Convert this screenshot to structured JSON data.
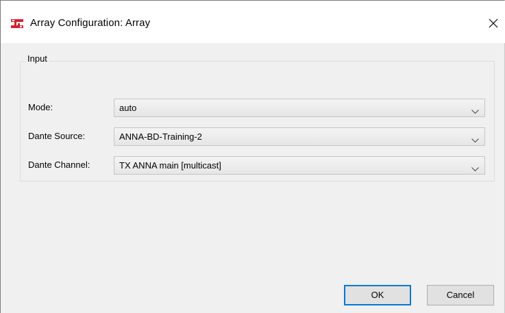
{
  "window": {
    "title": "Array Configuration: Array",
    "app_icon": "array-config-icon",
    "close_icon": "close-icon"
  },
  "input_group": {
    "legend": "Input",
    "fields": [
      {
        "label": "Mode:",
        "value": "auto"
      },
      {
        "label": "Dante Source:",
        "value": "ANNA-BD-Training-2"
      },
      {
        "label": "Dante Channel:",
        "value": "TX ANNA main [multicast]"
      }
    ]
  },
  "buttons": {
    "ok": "OK",
    "cancel": "Cancel"
  },
  "colors": {
    "accent": "#0078d7",
    "app_icon": "#d9202f"
  }
}
